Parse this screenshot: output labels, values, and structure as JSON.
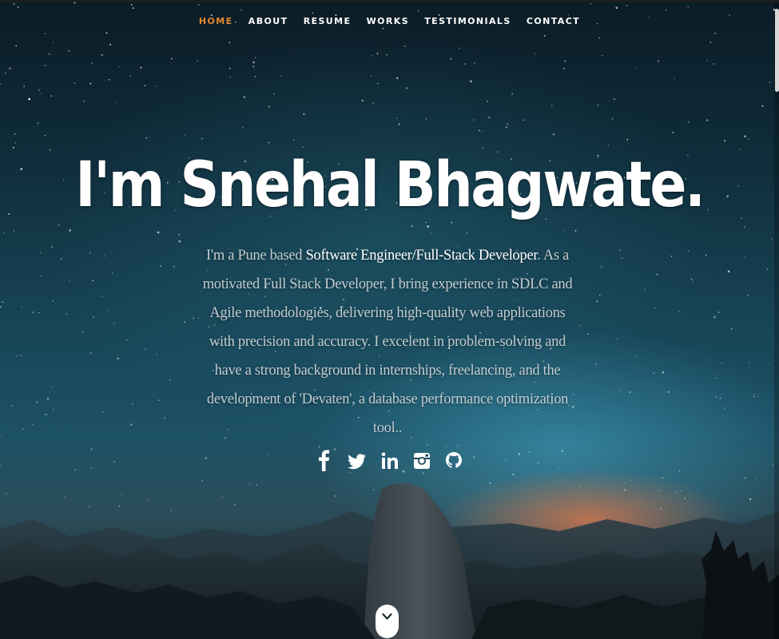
{
  "nav": {
    "items": [
      {
        "label": "HOME",
        "active": true
      },
      {
        "label": "ABOUT",
        "active": false
      },
      {
        "label": "RESUME",
        "active": false
      },
      {
        "label": "WORKS",
        "active": false
      },
      {
        "label": "TESTIMONIALS",
        "active": false
      },
      {
        "label": "CONTACT",
        "active": false
      }
    ],
    "active_color": "#e58a2f"
  },
  "hero": {
    "headline": "I'm Snehal Bhagwate.",
    "intro_prefix": "I'm a Pune based ",
    "intro_highlight": "Software Engineer/Full-Stack Developer",
    "intro_suffix": ". As a motivated Full Stack Developer, I bring experience in SDLC and Agile methodologies, delivering high-quality web applications with precision and accuracy. I excelent in problem-solving and have a strong background in internships, freelancing, and the development of 'Devaten', a database performance optimization tool.."
  },
  "social": [
    {
      "icon": "facebook-icon"
    },
    {
      "icon": "twitter-icon"
    },
    {
      "icon": "linkedin-icon"
    },
    {
      "icon": "instagram-icon"
    },
    {
      "icon": "github-icon"
    }
  ],
  "scroll": {
    "icon": "chevron-down-icon"
  }
}
